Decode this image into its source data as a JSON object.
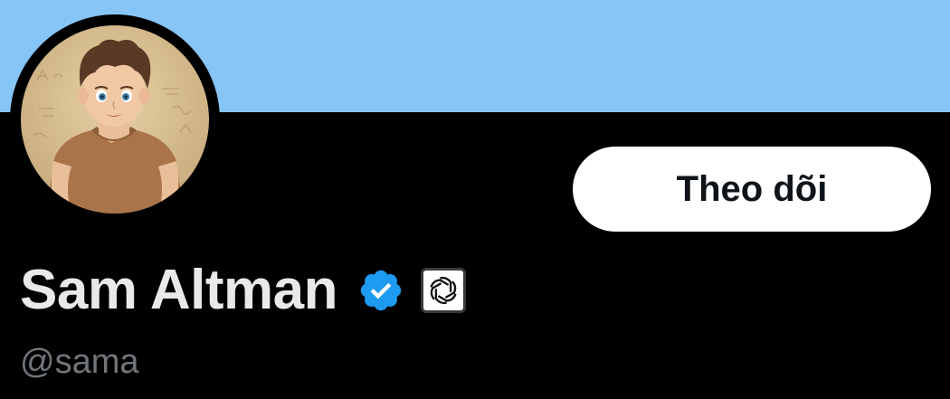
{
  "profile": {
    "display_name": "Sam Altman",
    "handle": "@sama",
    "verified_icon": "verified-badge-icon",
    "affiliate_icon": "openai-logo-icon"
  },
  "actions": {
    "follow_label": "Theo dõi"
  },
  "colors": {
    "banner": "#87c5f6",
    "background": "#000000",
    "name_text": "#e7e9ea",
    "handle_text": "#71767b",
    "verified_blue": "#1d9bf0",
    "follow_button_bg": "#ffffff",
    "follow_button_text": "#0f1419"
  }
}
